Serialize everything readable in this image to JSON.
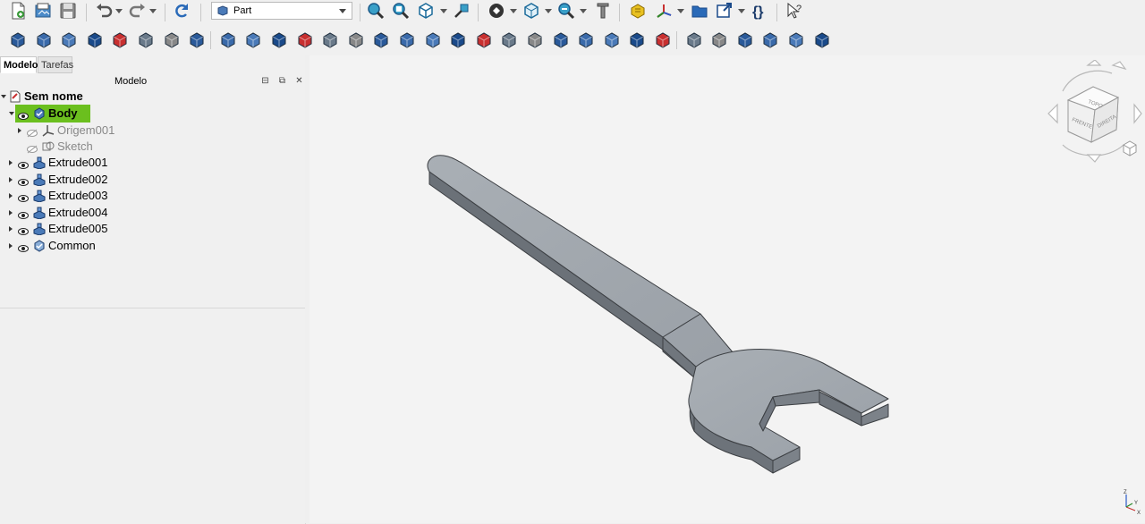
{
  "toolbar": {
    "workbench": "Part"
  },
  "toolbar_icons": {
    "row1": [
      "new-document-icon",
      "open-icon",
      "save-icon",
      "undo-icon",
      "redo-icon",
      "refresh-icon",
      "workbench-icon",
      "fit-all-icon",
      "fit-selection-icon",
      "std-views-icon",
      "select-bounds-icon",
      "draw-style-icon",
      "box-view-icon",
      "zoom-icon",
      "measure-icon",
      "part-icon",
      "origin-icon",
      "folder-icon",
      "link-icon",
      "braces-icon",
      "whats-this-icon"
    ],
    "row2": [
      "cube-icon",
      "cylinder-icon",
      "sphere-icon",
      "cone-icon",
      "torus-icon",
      "tube-icon",
      "primitives-icon",
      "shape-builder-icon",
      "extrude-icon",
      "revolve-icon",
      "mirror-icon",
      "fillet-icon",
      "chamfer-icon",
      "make-face-icon",
      "ruled-surface-icon",
      "loft-icon",
      "sweep-icon",
      "section-icon",
      "cross-sections-icon",
      "offset-icon",
      "thickness-icon",
      "projection-icon",
      "attachment-icon",
      "compound-icon",
      "boolean-icon",
      "cut-icon",
      "fuse-icon",
      "common-icon",
      "check-geometry-icon",
      "defeaturing-icon",
      "join-icon",
      "split-icon"
    ]
  },
  "panel": {
    "tabs": [
      "Modelo",
      "Tarefas"
    ],
    "header_title": "Modelo",
    "tree": [
      {
        "label": "Sem nome",
        "level": 0
      },
      {
        "label": "Body",
        "level": 1
      },
      {
        "label": "Origem001",
        "level": 2
      },
      {
        "label": "Sketch",
        "level": 2
      },
      {
        "label": "Extrude001",
        "level": 1
      },
      {
        "label": "Extrude002",
        "level": 1
      },
      {
        "label": "Extrude003",
        "level": 1
      },
      {
        "label": "Extrude004",
        "level": 1
      },
      {
        "label": "Extrude005",
        "level": 1
      },
      {
        "label": "Common",
        "level": 1
      }
    ]
  },
  "navcube": {
    "faces": [
      "TOPO",
      "FRENTE",
      "DIREITA"
    ]
  },
  "axis": {
    "labels": [
      "Z",
      "Y",
      "X"
    ]
  }
}
